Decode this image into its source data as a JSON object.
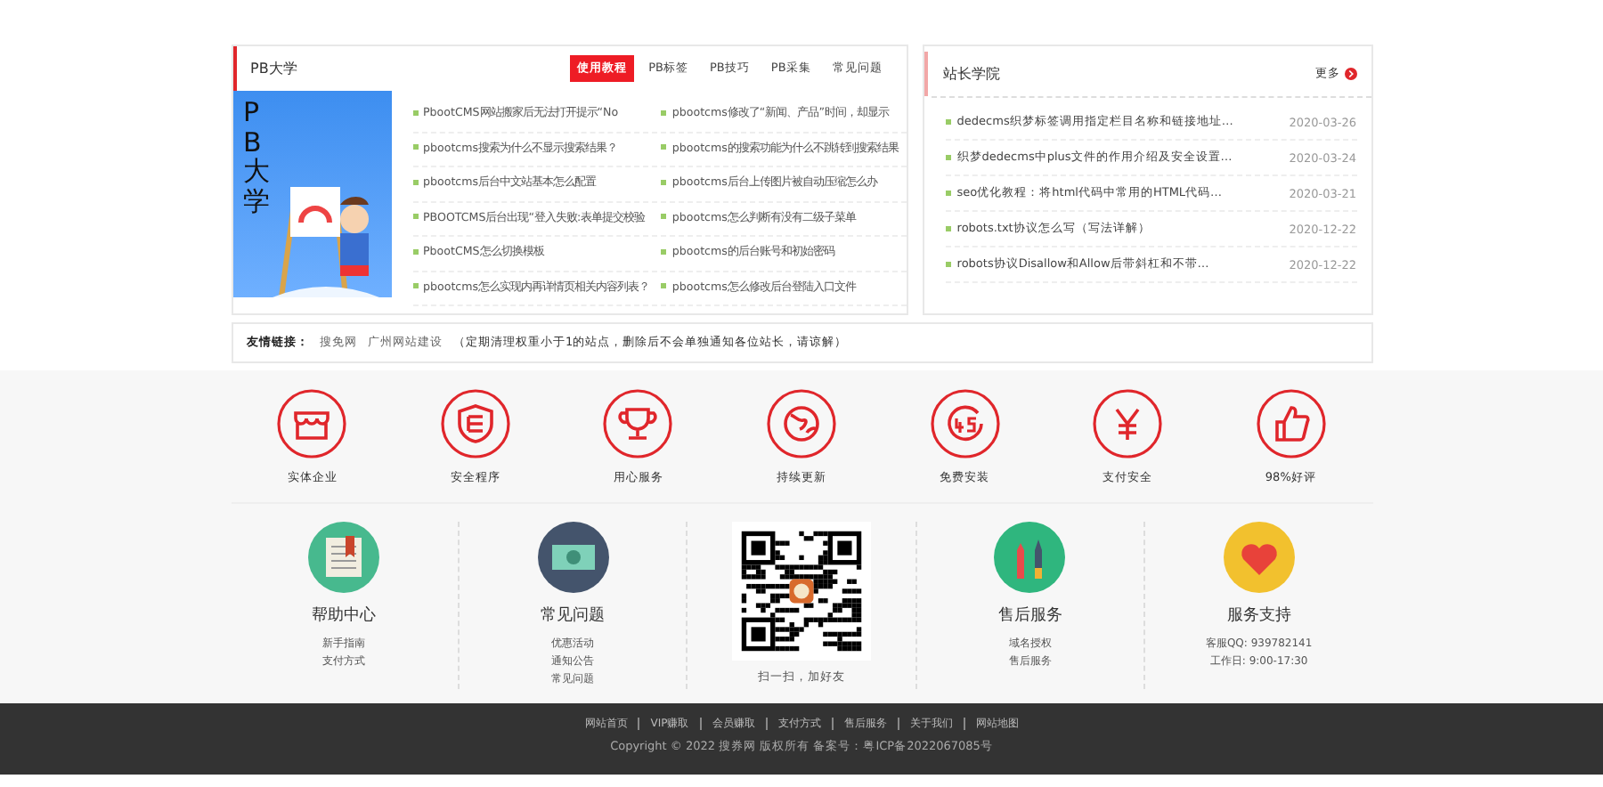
{
  "pb_box": {
    "title": "PB大学",
    "tabs": [
      {
        "label": "使用教程",
        "selected": true
      },
      {
        "label": "PB标签",
        "selected": false
      },
      {
        "label": "PB技巧",
        "selected": false
      },
      {
        "label": "PB采集",
        "selected": false
      },
      {
        "label": "常见问题",
        "selected": false
      }
    ],
    "image_text": "PB大学",
    "articles": [
      {
        "title": "PbootCMS网站搬家后无法打开提示“No"
      },
      {
        "title": "pbootcms修改了“新闻、产品”时间，却显示"
      },
      {
        "title": "pbootcms搜索为什么不显示搜索结果？"
      },
      {
        "title": "pbootcms的搜索功能为什么不跳转到搜索结果"
      },
      {
        "title": "pbootcms后台中文站基本怎么配置"
      },
      {
        "title": "pbootcms后台上传图片被自动压缩怎么办"
      },
      {
        "title": "PBOOTCMS后台出现“登入失败:表单提交校验"
      },
      {
        "title": "pbootcms怎么判断有没有二级子菜单"
      },
      {
        "title": "PbootCMS怎么切换模板"
      },
      {
        "title": "pbootcms的后台账号和初始密码"
      },
      {
        "title": "pbootcms怎么实现内再详情页相关内容列表？"
      },
      {
        "title": "pbootcms怎么修改后台登陆入口文件"
      }
    ]
  },
  "news_box": {
    "title": "站长学院",
    "more": "更多",
    "items": [
      {
        "title": "dedecms织梦标签调用指定栏目名称和链接地址…",
        "date": "2020-03-26"
      },
      {
        "title": "织梦dedecms中plus文件的作用介绍及安全设置…",
        "date": "2020-03-24"
      },
      {
        "title": "seo优化教程：将html代码中常用的HTML代码…",
        "date": "2020-03-21"
      },
      {
        "title": "robots.txt协议怎么写（写法详解）",
        "date": "2020-12-22"
      },
      {
        "title": "robots协议Disallow和Allow后带斜杠和不带…",
        "date": "2020-12-22"
      }
    ]
  },
  "friend_links": {
    "label": "友情链接：",
    "links": [
      "搜免网",
      "广州网站建设"
    ],
    "note": "（定期清理权重小于1的站点，删除后不会单独通知各位站长，请谅解）"
  },
  "features": [
    {
      "kind": "store",
      "label": "实体企业"
    },
    {
      "kind": "shield",
      "label": "安全程序"
    },
    {
      "kind": "trophy",
      "label": "用心服务"
    },
    {
      "kind": "globe",
      "label": "持续更新"
    },
    {
      "kind": "clock45",
      "label": "免费安装"
    },
    {
      "kind": "yen",
      "label": "支付安全"
    },
    {
      "kind": "thumb",
      "label": "98%好评"
    }
  ],
  "services": [
    {
      "kind": "book",
      "title": "帮助中心",
      "lines": [
        "新手指南",
        "支付方式"
      ]
    },
    {
      "kind": "money",
      "title": "常见问题",
      "lines": [
        "优惠活动",
        "通知公告",
        "常见问题"
      ]
    },
    {
      "kind": "qrcode",
      "caption": "扫一扫，加好友"
    },
    {
      "kind": "pens",
      "title": "售后服务",
      "lines": [
        "域名授权",
        "售后服务"
      ]
    },
    {
      "kind": "heart",
      "title": "服务支持",
      "lines": [
        "客服QQ: 939782141",
        "工作日: 9:00-17:30"
      ]
    }
  ],
  "footer": {
    "links": [
      "网站首页",
      "VIP赚取",
      "会员赚取",
      "支付方式",
      "售后服务",
      "关于我们",
      "网站地图"
    ],
    "copyright": "Copyright © 2022 搜券网 版权所有 备案号：粤ICP备2022067085号"
  }
}
